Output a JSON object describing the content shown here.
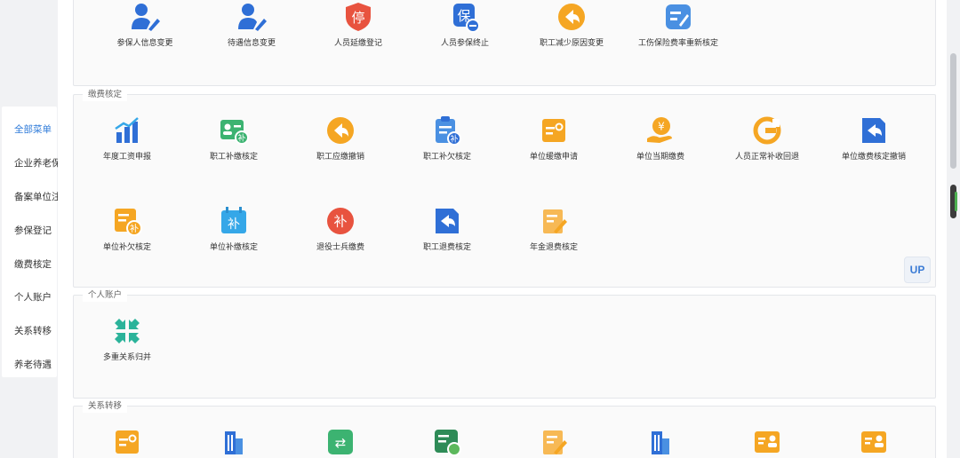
{
  "sidebar": {
    "items": [
      {
        "label": "全部菜单",
        "active": true
      },
      {
        "label": "企业养老保险",
        "active": false
      },
      {
        "label": "备案单位注册",
        "active": false
      },
      {
        "label": "参保登记",
        "active": false
      },
      {
        "label": "缴费核定",
        "active": false
      },
      {
        "label": "个人账户",
        "active": false
      },
      {
        "label": "关系转移",
        "active": false
      },
      {
        "label": "养老待遇",
        "active": false
      }
    ]
  },
  "top_section": {
    "tiles": [
      {
        "label": "参保人信息变更",
        "icon": "user-pen-icon"
      },
      {
        "label": "待遇信息变更",
        "icon": "user-pen-icon"
      },
      {
        "label": "人员延缴登记",
        "icon": "stop-shield-icon",
        "glyph": "停"
      },
      {
        "label": "人员参保终止",
        "icon": "bao-minus-icon",
        "glyph": "保"
      },
      {
        "label": "职工减少原因变更",
        "icon": "return-arrow-icon"
      },
      {
        "label": "工伤保险费率重新核定",
        "icon": "edit-list-icon"
      }
    ]
  },
  "jiaofei": {
    "title": "缴费核定",
    "tiles": [
      {
        "label": "年度工资申报",
        "icon": "bar-chart-icon"
      },
      {
        "label": "职工补缴核定",
        "icon": "id-card-supplement-icon",
        "glyph": "补"
      },
      {
        "label": "职工应缴撤销",
        "icon": "return-arrow-icon"
      },
      {
        "label": "职工补欠核定",
        "icon": "clipboard-supplement-icon",
        "glyph": "补"
      },
      {
        "label": "单位缓缴申请",
        "icon": "certificate-icon"
      },
      {
        "label": "单位当期缴费",
        "icon": "yuan-hand-icon",
        "glyph": "¥"
      },
      {
        "label": "人员正常补收回退",
        "icon": "rollback-icon",
        "glyph": "C"
      },
      {
        "label": "单位缴费核定撤销",
        "icon": "doc-return-icon"
      },
      {
        "label": "单位补欠核定",
        "icon": "list-supplement-icon",
        "glyph": "补"
      },
      {
        "label": "单位补缴核定",
        "icon": "calendar-supplement-icon",
        "glyph": "补"
      },
      {
        "label": "退役士兵缴费",
        "icon": "supplement-circle-icon",
        "glyph": "补"
      },
      {
        "label": "职工退费核定",
        "icon": "doc-return-icon"
      },
      {
        "label": "年金退费核定",
        "icon": "doc-edit-icon"
      }
    ]
  },
  "geren": {
    "title": "个人账户",
    "tiles": [
      {
        "label": "多重关系归并",
        "icon": "merge-arrows-icon"
      }
    ]
  },
  "guanxi": {
    "title": "关系转移",
    "tiles": [
      {
        "icon": "certificate-icon"
      },
      {
        "icon": "building-icon"
      },
      {
        "icon": "transfer-icon",
        "glyph": "⇄"
      },
      {
        "icon": "id-check-icon"
      },
      {
        "icon": "doc-edit-icon"
      },
      {
        "icon": "building-icon"
      },
      {
        "icon": "contact-card-icon"
      },
      {
        "icon": "contact-card-icon"
      }
    ]
  },
  "up_label": "UP",
  "colors": {
    "blue": "#2f6fd6",
    "light_blue": "#35a7e8",
    "orange": "#f5a623",
    "red": "#e8533f",
    "green": "#3cb371",
    "teal": "#2bb39a"
  }
}
